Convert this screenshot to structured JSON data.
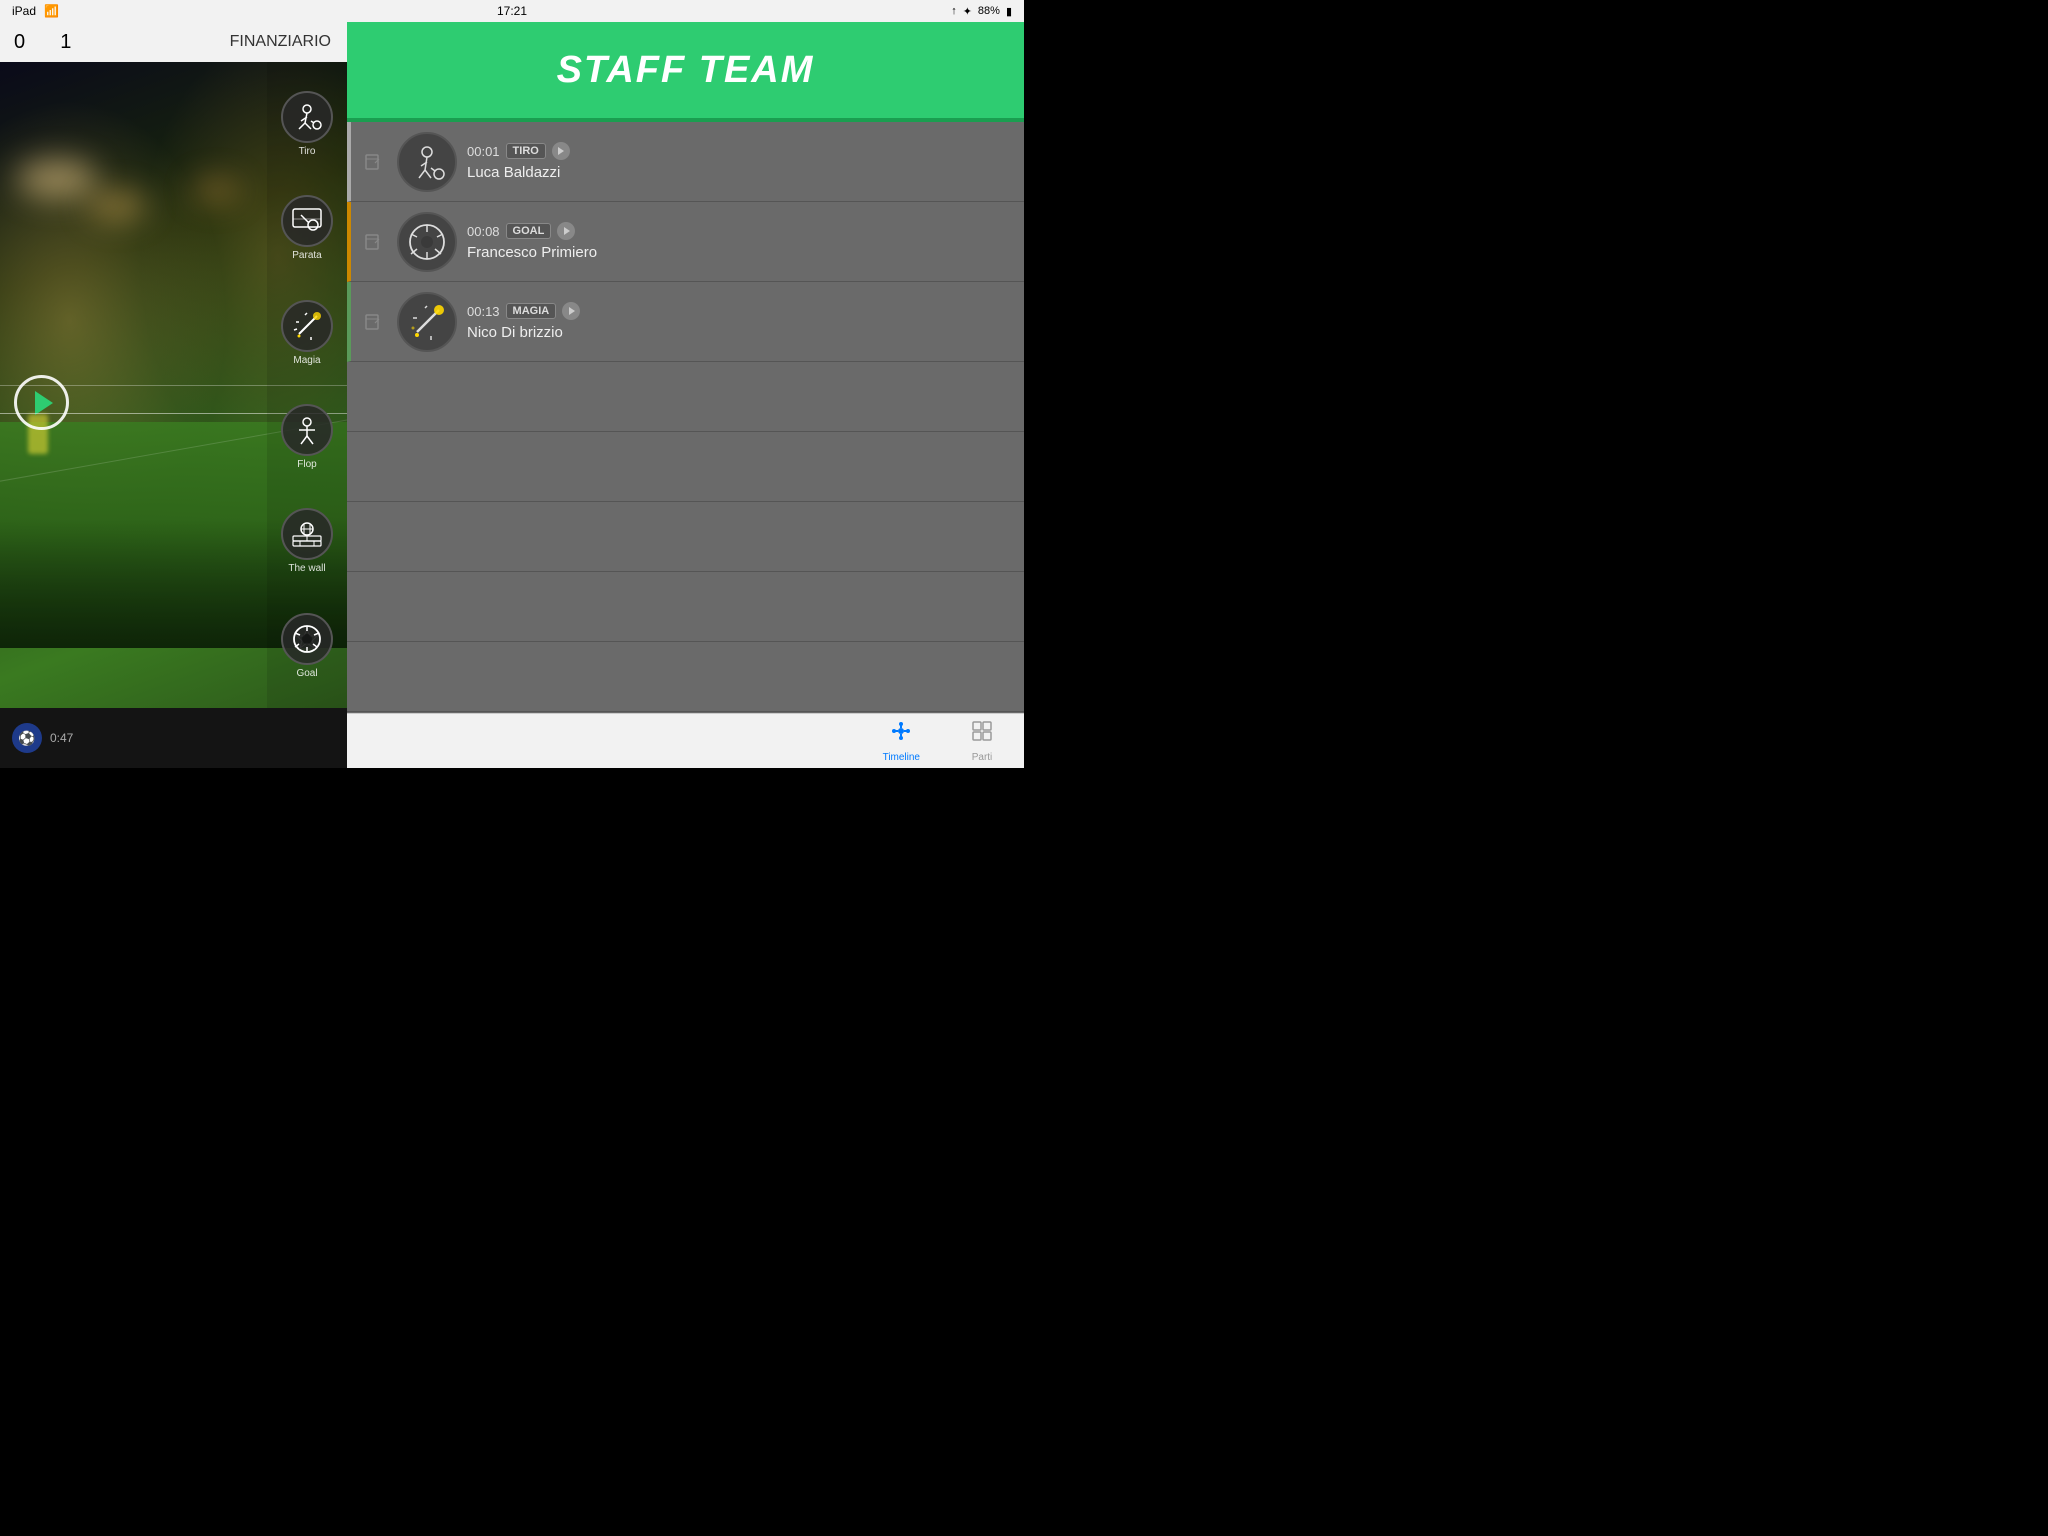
{
  "statusBar": {
    "device": "iPad",
    "wifi": "wifi-icon",
    "time": "17:21",
    "location": "location-icon",
    "bluetooth": "bluetooth-icon",
    "battery": "88%",
    "batteryIcon": "battery-icon"
  },
  "titleBar": {
    "score1": "0",
    "score2": "1",
    "teamName": "FINANZIARIO"
  },
  "actionButtons": [
    {
      "id": "tiro",
      "label": "Tiro",
      "icon": "🏃"
    },
    {
      "id": "parata",
      "label": "Parata",
      "icon": "🧤"
    },
    {
      "id": "magia",
      "label": "Magia",
      "icon": "✨"
    },
    {
      "id": "flop",
      "label": "Flop",
      "icon": "🤕"
    },
    {
      "id": "thewall",
      "label": "The wall",
      "icon": "🧱"
    },
    {
      "id": "goal",
      "label": "Goal",
      "icon": "⚽"
    }
  ],
  "staffPanel": {
    "title": "STAFF TEAM",
    "events": [
      {
        "time": "00:01",
        "tag": "TIRO",
        "playerName": "Luca Baldazzi",
        "avatarIcon": "🏃",
        "type": "tiro"
      },
      {
        "time": "00:08",
        "tag": "GOAL",
        "playerName": "Francesco  Primiero",
        "avatarIcon": "⚽",
        "type": "goal"
      },
      {
        "time": "00:13",
        "tag": "MAGIA",
        "playerName": "Nico Di brizzio",
        "avatarIcon": "✨",
        "type": "magia"
      }
    ]
  },
  "tabBar": {
    "tabs": [
      {
        "id": "timeline",
        "label": "Timeline",
        "icon": "timeline",
        "active": true
      },
      {
        "id": "parti",
        "label": "Parti",
        "icon": "grid",
        "active": false
      }
    ]
  }
}
